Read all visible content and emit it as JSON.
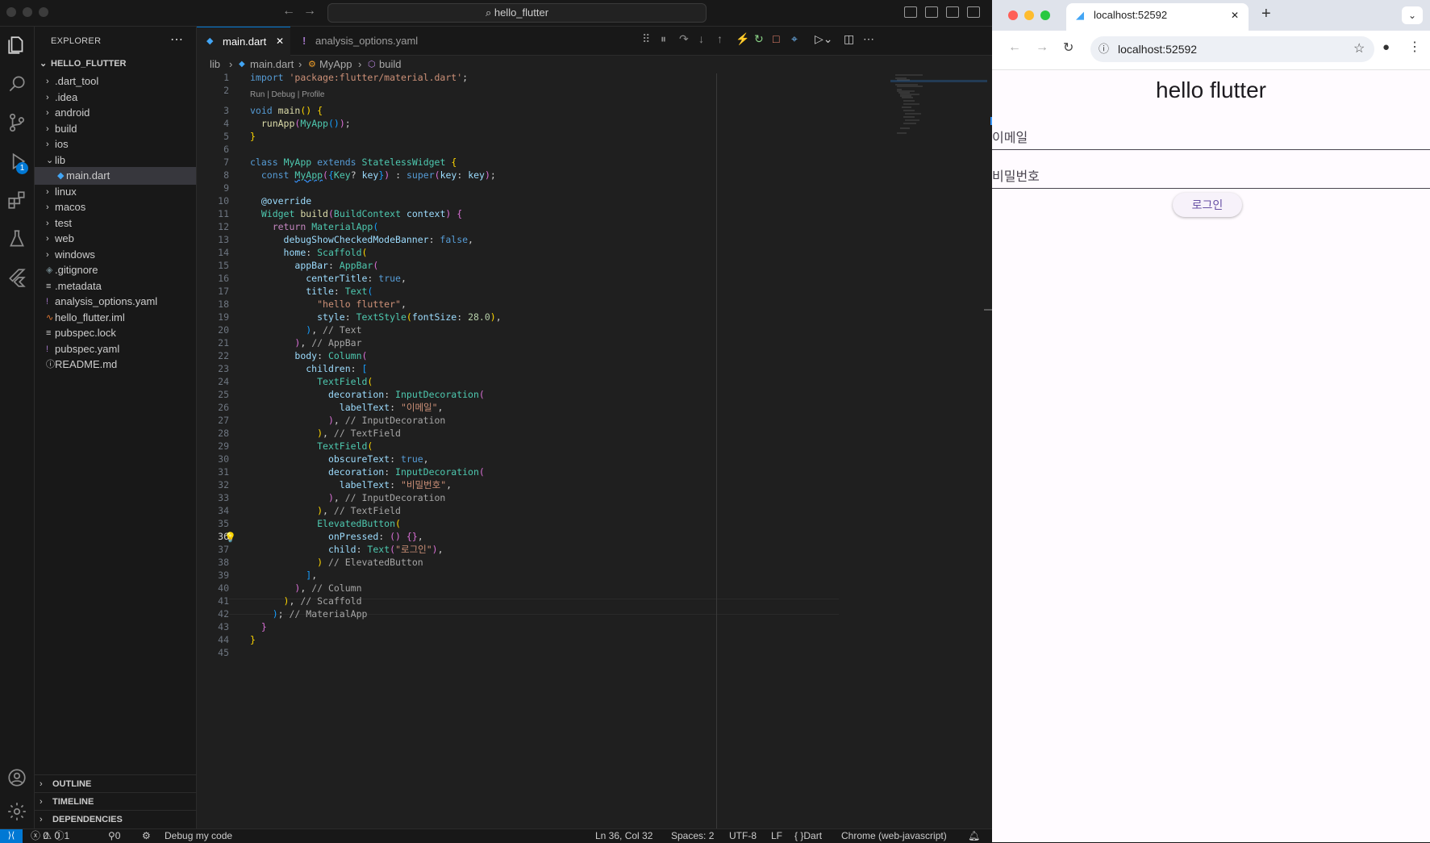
{
  "vscode": {
    "command_center": "hello_flutter",
    "explorer_title": "EXPLORER",
    "project": "HELLO_FLUTTER",
    "tree": [
      {
        "name": ".dart_tool",
        "type": "folder",
        "depth": 1
      },
      {
        "name": ".idea",
        "type": "folder",
        "depth": 1
      },
      {
        "name": "android",
        "type": "folder",
        "depth": 1
      },
      {
        "name": "build",
        "type": "folder",
        "depth": 1
      },
      {
        "name": "ios",
        "type": "folder",
        "depth": 1
      },
      {
        "name": "lib",
        "type": "folder-open",
        "depth": 1
      },
      {
        "name": "main.dart",
        "type": "dart",
        "depth": 2,
        "selected": true
      },
      {
        "name": "linux",
        "type": "folder",
        "depth": 1
      },
      {
        "name": "macos",
        "type": "folder",
        "depth": 1
      },
      {
        "name": "test",
        "type": "folder",
        "depth": 1
      },
      {
        "name": "web",
        "type": "folder",
        "depth": 1
      },
      {
        "name": "windows",
        "type": "folder",
        "depth": 1
      },
      {
        "name": ".gitignore",
        "type": "git",
        "depth": 1
      },
      {
        "name": ".metadata",
        "type": "text",
        "depth": 1
      },
      {
        "name": "analysis_options.yaml",
        "type": "yaml",
        "depth": 1
      },
      {
        "name": "hello_flutter.iml",
        "type": "rss",
        "depth": 1
      },
      {
        "name": "pubspec.lock",
        "type": "text",
        "depth": 1
      },
      {
        "name": "pubspec.yaml",
        "type": "yaml",
        "depth": 1
      },
      {
        "name": "README.md",
        "type": "info",
        "depth": 1
      }
    ],
    "panels": [
      "OUTLINE",
      "TIMELINE",
      "DEPENDENCIES"
    ],
    "tabs": [
      {
        "label": "main.dart",
        "active": true
      },
      {
        "label": "analysis_options.yaml",
        "active": false
      }
    ],
    "breadcrumb": [
      "lib",
      "main.dart",
      "MyApp",
      "build"
    ],
    "codelens": "Run | Debug | Profile",
    "debug_badge": "1",
    "current_line": 36,
    "status": {
      "errors": "0",
      "warnings": "0",
      "info": "1",
      "ports": "0",
      "debug": "Debug my code",
      "position": "Ln 36, Col 32",
      "spaces": "Spaces: 2",
      "encoding": "UTF-8",
      "eol": "LF",
      "language": "Dart",
      "device": "Chrome (web-javascript)"
    }
  },
  "chrome": {
    "tab_title": "localhost:52592",
    "url": "localhost:52592",
    "app_title": "hello flutter",
    "email_label": "이메일",
    "password_label": "비밀번호",
    "login_button": "로그인"
  },
  "colors": {
    "accent": "#0078d4",
    "editor_bg": "#1f1f1f",
    "flutter_primary": "#6750a4"
  }
}
